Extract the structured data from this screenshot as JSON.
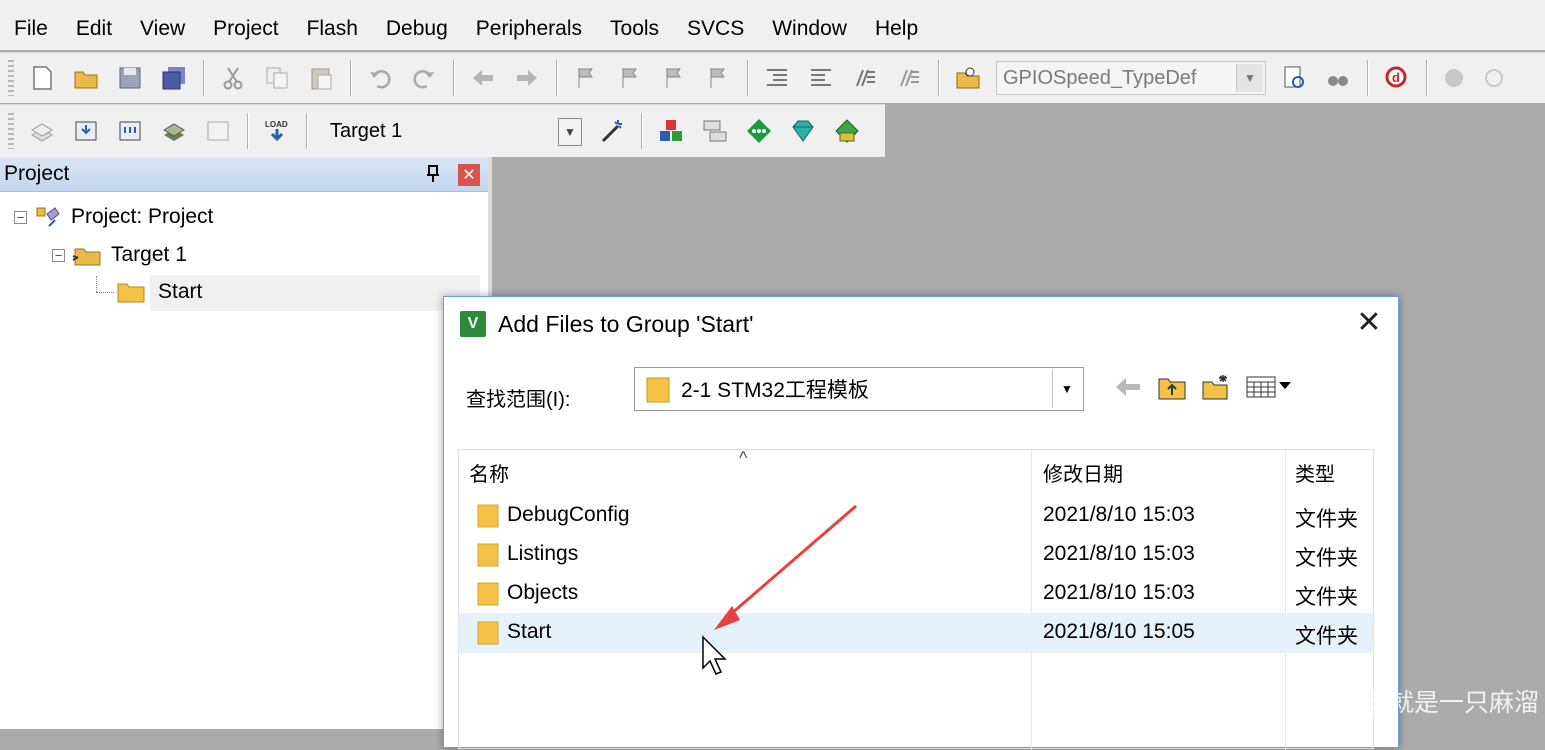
{
  "menu": [
    "File",
    "Edit",
    "View",
    "Project",
    "Flash",
    "Debug",
    "Peripherals",
    "Tools",
    "SVCS",
    "Window",
    "Help"
  ],
  "toolbar": {
    "find_combo_value": "GPIOSpeed_TypeDef",
    "target_value": "Target 1"
  },
  "project_panel": {
    "title": "Project",
    "tree": {
      "project_label": "Project: Project",
      "target_label": "Target 1",
      "group_label": "Start"
    }
  },
  "dialog": {
    "title": "Add Files to Group 'Start'",
    "look_in_label": "查找范围(I):",
    "look_in_value": "2-1 STM32工程模板",
    "columns": {
      "name": "名称",
      "modified": "修改日期",
      "type": "类型"
    },
    "files": [
      {
        "name": "DebugConfig",
        "modified": "2021/8/10 15:03",
        "type": "文件夹"
      },
      {
        "name": "Listings",
        "modified": "2021/8/10 15:03",
        "type": "文件夹"
      },
      {
        "name": "Objects",
        "modified": "2021/8/10 15:03",
        "type": "文件夹"
      },
      {
        "name": "Start",
        "modified": "2021/8/10 15:05",
        "type": "文件夹"
      }
    ],
    "selected_file_index": 3
  },
  "watermark": "CSDN @就是一只麻溜",
  "colors": {
    "folder": "#f3c247",
    "selection": "#e5f1fb",
    "annotation_arrow": "#e8403a",
    "panel_header": "#c3d6ee"
  }
}
